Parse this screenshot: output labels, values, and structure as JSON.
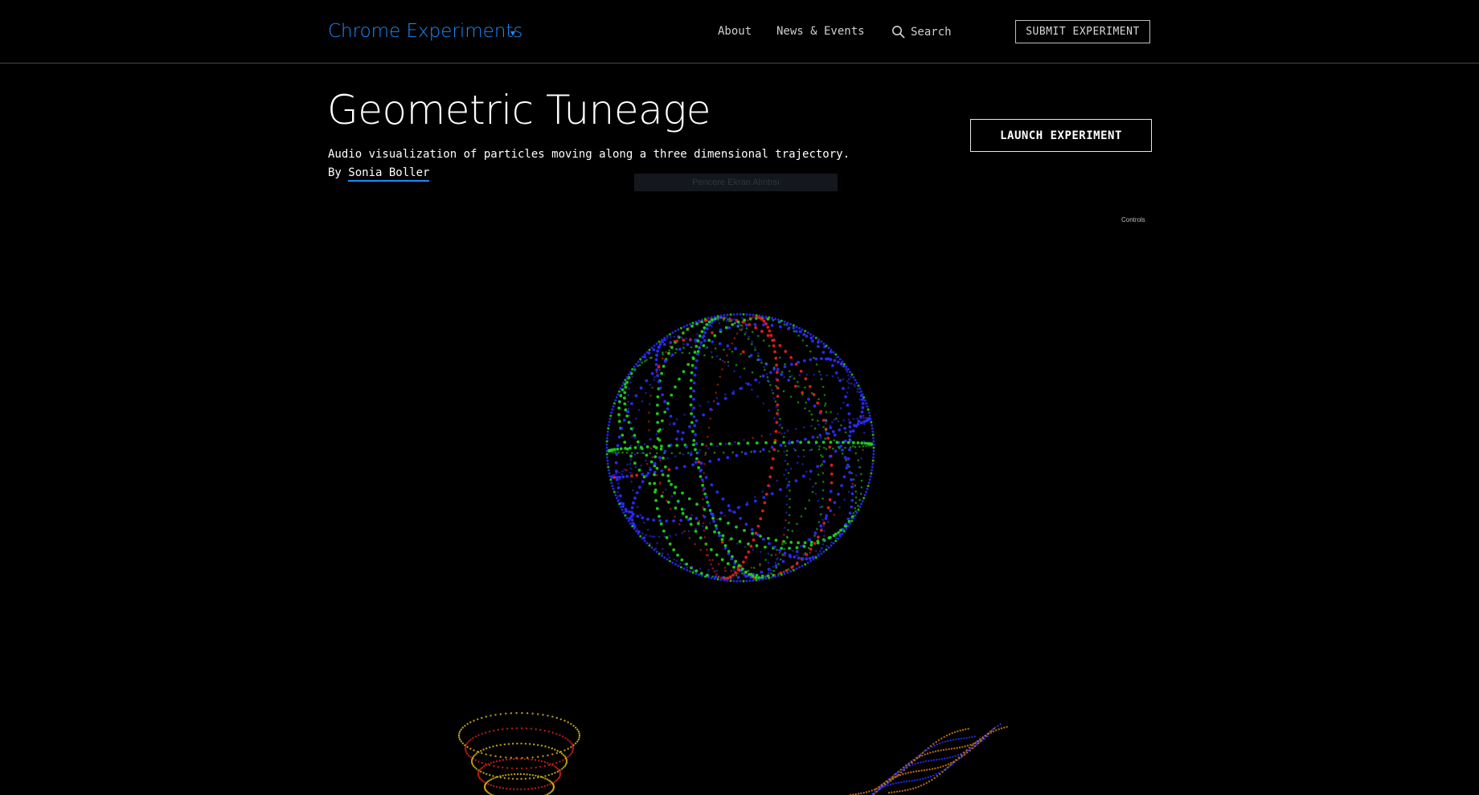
{
  "header": {
    "brand": "Chrome Experiments",
    "brand_caret": "▾",
    "nav": {
      "about": "About",
      "news": "News & Events",
      "search": "Search"
    },
    "submit_label": "SUBMIT EXPERIMENT"
  },
  "experiment": {
    "title": "Geometric Tuneage",
    "description": "Audio visualization of particles moving along a three dimensional trajectory.",
    "by_prefix": "By",
    "author": "Sonia Boller",
    "launch_label": "LAUNCH EXPERIMENT",
    "controls_label": "Controls",
    "overlay_text": "Pencere Ekran Alıntısı"
  },
  "colors": {
    "accent": "#1a8cff",
    "background": "#000000",
    "particle_colors": [
      "#2b2bff",
      "#1fd11f",
      "#e01f1f",
      "#e6c21a",
      "#d07a10"
    ]
  },
  "icons": {
    "search": "search-icon",
    "caret": "caret-down-icon"
  }
}
